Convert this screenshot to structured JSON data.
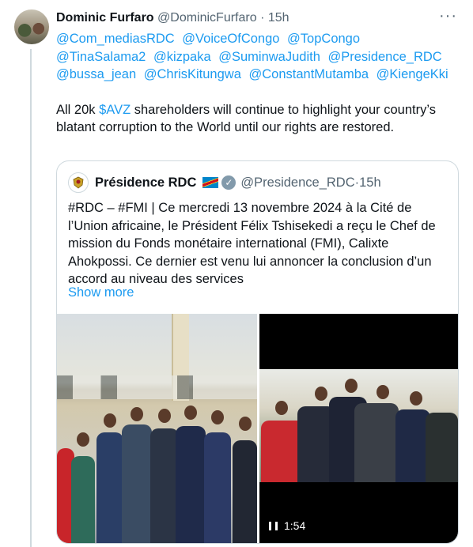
{
  "tweet": {
    "author_name": "Dominic Furfaro",
    "author_handle": "@DominicFurfaro",
    "separator": "·",
    "time": "15h",
    "more": "···",
    "mentions": [
      "@Com_mediasRDC",
      "@VoiceOfCongo",
      "@TopCongo",
      "@TinaSalama2",
      "@kizpaka",
      "@SuminwaJudith",
      "@Presidence_RDC",
      "@bussa_jean",
      "@ChrisKitungwa",
      "@ConstantMutamba",
      "@KiengeKki"
    ],
    "text_before": "All 20k ",
    "cashtag": "$AVZ",
    "text_after": " shareholders will continue to highlight your country’s blatant corruption to the World until our rights are restored."
  },
  "quote": {
    "author_name": "Présidence RDC",
    "author_handle": "@Presidence_RDC",
    "separator": "·",
    "time": "15h",
    "text": "#RDC – #FMI | Ce mercredi 13 novembre 2024 à la Cité de l’Union africaine, le Président Félix Tshisekedi a reçu le Chef de mission du Fonds monétaire international (FMI), Calixte Ahokpossi. Ce dernier est venu lui annoncer la conclusion d’un accord au niveau des services",
    "show_more": "Show more",
    "video_duration": "1:54"
  }
}
